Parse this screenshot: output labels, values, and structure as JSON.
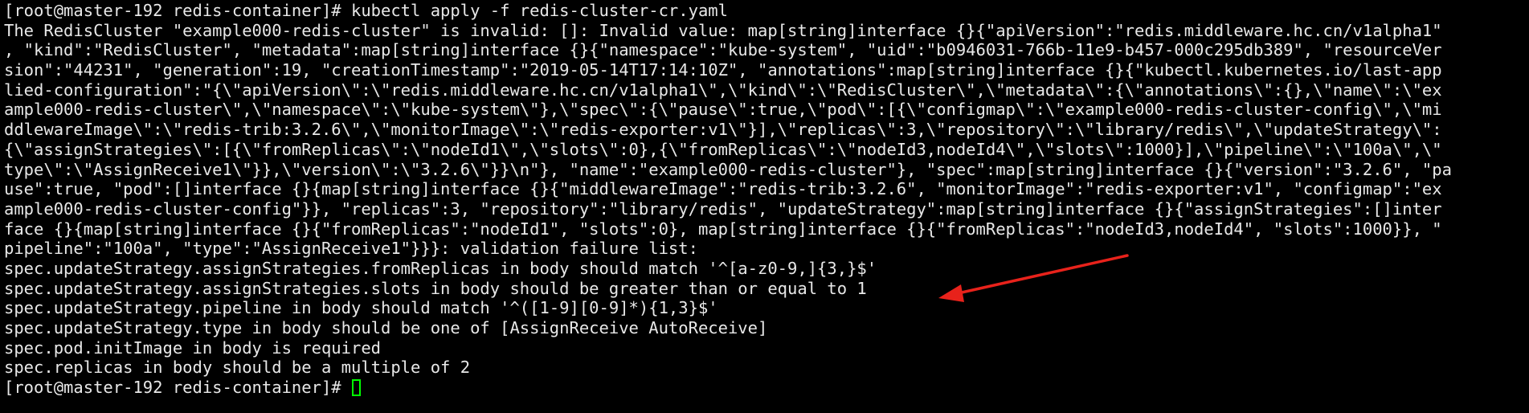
{
  "terminal": {
    "lines": [
      "[root@master-192 redis-container]# kubectl apply -f redis-cluster-cr.yaml",
      "The RedisCluster \"example000-redis-cluster\" is invalid: []: Invalid value: map[string]interface {}{\"apiVersion\":\"redis.middleware.hc.cn/v1alpha1\"",
      ", \"kind\":\"RedisCluster\", \"metadata\":map[string]interface {}{\"namespace\":\"kube-system\", \"uid\":\"b0946031-766b-11e9-b457-000c295db389\", \"resourceVer",
      "sion\":\"44231\", \"generation\":19, \"creationTimestamp\":\"2019-05-14T17:14:10Z\", \"annotations\":map[string]interface {}{\"kubectl.kubernetes.io/last-app",
      "lied-configuration\":\"{\\\"apiVersion\\\":\\\"redis.middleware.hc.cn/v1alpha1\\\",\\\"kind\\\":\\\"RedisCluster\\\",\\\"metadata\\\":{\\\"annotations\\\":{},\\\"name\\\":\\\"ex",
      "ample000-redis-cluster\\\",\\\"namespace\\\":\\\"kube-system\\\"},\\\"spec\\\":{\\\"pause\\\":true,\\\"pod\\\":[{\\\"configmap\\\":\\\"example000-redis-cluster-config\\\",\\\"mi",
      "ddlewareImage\\\":\\\"redis-trib:3.2.6\\\",\\\"monitorImage\\\":\\\"redis-exporter:v1\\\"}],\\\"replicas\\\":3,\\\"repository\\\":\\\"library/redis\\\",\\\"updateStrategy\\\":",
      "{\\\"assignStrategies\\\":[{\\\"fromReplicas\\\":\\\"nodeId1\\\",\\\"slots\\\":0},{\\\"fromReplicas\\\":\\\"nodeId3,nodeId4\\\",\\\"slots\\\":1000}],\\\"pipeline\\\":\\\"100a\\\",\\\"",
      "type\\\":\\\"AssignReceive1\\\"}},\\\"version\\\":\\\"3.2.6\\\"}}\\n\"}, \"name\":\"example000-redis-cluster\"}, \"spec\":map[string]interface {}{\"version\":\"3.2.6\", \"pa",
      "use\":true, \"pod\":[]interface {}{map[string]interface {}{\"middlewareImage\":\"redis-trib:3.2.6\", \"monitorImage\":\"redis-exporter:v1\", \"configmap\":\"ex",
      "ample000-redis-cluster-config\"}}, \"replicas\":3, \"repository\":\"library/redis\", \"updateStrategy\":map[string]interface {}{\"assignStrategies\":[]inter",
      "face {}{map[string]interface {}{\"fromReplicas\":\"nodeId1\", \"slots\":0}, map[string]interface {}{\"fromReplicas\":\"nodeId3,nodeId4\", \"slots\":1000}}, \"",
      "pipeline\":\"100a\", \"type\":\"AssignReceive1\"}}}: validation failure list:",
      "spec.updateStrategy.assignStrategies.fromReplicas in body should match '^[a-z0-9,]{3,}$'",
      "spec.updateStrategy.assignStrategies.slots in body should be greater than or equal to 1",
      "spec.updateStrategy.pipeline in body should match '^([1-9][0-9]*){1,3}$'",
      "spec.updateStrategy.type in body should be one of [AssignReceive AutoReceive]",
      "spec.pod.initImage in body is required",
      "spec.replicas in body should be a multiple of 2"
    ],
    "prompt": "[root@master-192 redis-container]# ",
    "text_color": "#e8e8e8",
    "background_color": "#000000",
    "cursor_color": "#00ff00",
    "arrow_color": "#e8221b"
  }
}
